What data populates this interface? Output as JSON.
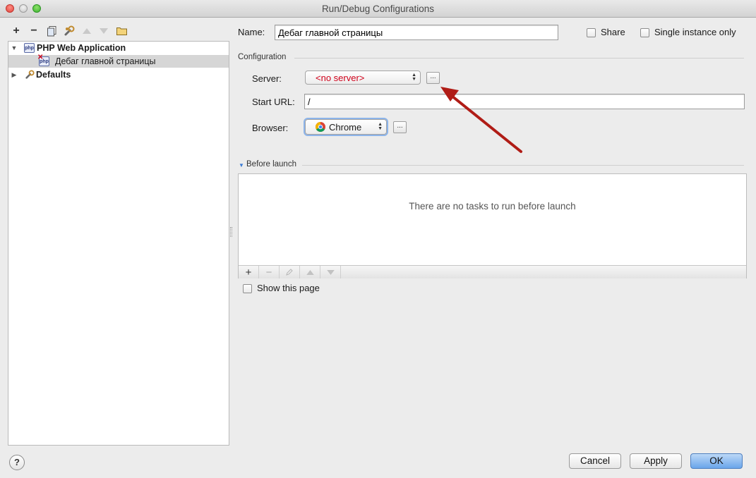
{
  "window": {
    "title": "Run/Debug Configurations"
  },
  "toolbar": {
    "add": "+",
    "remove": "−",
    "copy_icon": "copy-icon",
    "edit_defaults_icon": "wrench-icon",
    "move_up_icon": "arrow-up-icon",
    "move_down_icon": "arrow-down-icon",
    "folder_icon": "folder-icon"
  },
  "tree": {
    "items": [
      {
        "label": "PHP Web Application",
        "icon": "php-icon",
        "expanded": true
      },
      {
        "label": "Дебаг главной страницы",
        "icon": "php-run-config-icon",
        "selected": true
      },
      {
        "label": "Defaults",
        "icon": "wrench-icon",
        "expanded": false
      }
    ]
  },
  "form": {
    "name_label": "Name:",
    "name_value": "Дебаг главной страницы",
    "share_label": "Share",
    "single_instance_label": "Single instance only",
    "configuration_label": "Configuration",
    "server_label": "Server:",
    "server_value": "<no server>",
    "server_value_color": "#d0021b",
    "start_url_label": "Start URL:",
    "start_url_value": "/",
    "browser_label": "Browser:",
    "browser_value": "Chrome",
    "browse_button": "..."
  },
  "before_launch": {
    "label": "Before launch",
    "empty_text": "There are no tasks to run before launch",
    "show_this_page_label": "Show this page"
  },
  "buttons": {
    "help": "?",
    "cancel": "Cancel",
    "apply": "Apply",
    "ok": "OK"
  },
  "annotation": {
    "arrow_color": "#b01c16"
  }
}
